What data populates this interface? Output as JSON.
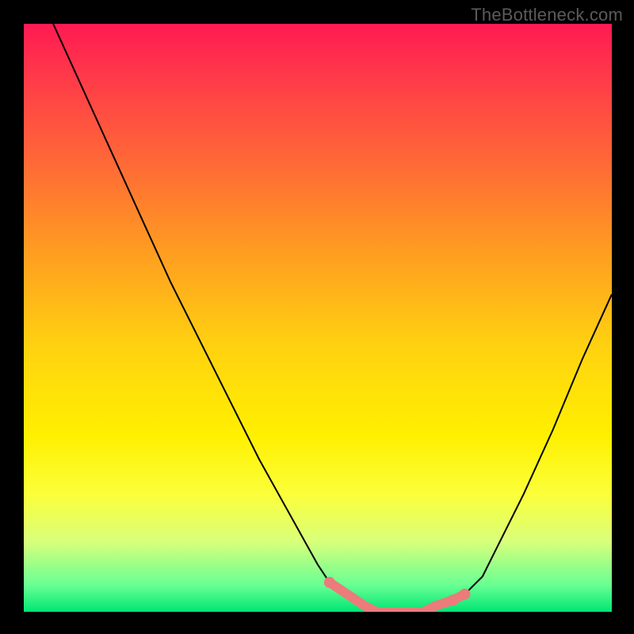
{
  "watermark": "TheBottleneck.com",
  "colors": {
    "background": "#000000",
    "marker": "#ec7b7b",
    "curve": "#000000",
    "gradient": [
      "#ff1a52",
      "#ff3d48",
      "#ff6a36",
      "#ffa11f",
      "#ffd210",
      "#fff000",
      "#fbff3a",
      "#d9ff7a",
      "#67ff93",
      "#00e674"
    ]
  },
  "chart_data": {
    "type": "line",
    "title": "",
    "xlabel": "",
    "ylabel": "",
    "xlim": [
      0,
      100
    ],
    "ylim": [
      0,
      100
    ],
    "series": [
      {
        "name": "bottleneck-curve",
        "x": [
          5,
          10,
          15,
          20,
          25,
          30,
          35,
          40,
          45,
          50,
          52,
          55,
          58,
          60,
          63,
          65,
          68,
          70,
          73,
          75,
          78,
          80,
          85,
          90,
          95,
          100
        ],
        "y": [
          100,
          89,
          78,
          67,
          56,
          46,
          36,
          26,
          17,
          8,
          5,
          3,
          1,
          0,
          0,
          0,
          0,
          1,
          2,
          3,
          6,
          10,
          20,
          31,
          43,
          54
        ]
      }
    ],
    "markers": {
      "name": "valley-highlight",
      "x": [
        52,
        55,
        58,
        60,
        63,
        65,
        68,
        70,
        73,
        75
      ],
      "y": [
        5,
        3,
        1,
        0,
        0,
        0,
        0,
        1,
        2,
        3
      ]
    }
  }
}
